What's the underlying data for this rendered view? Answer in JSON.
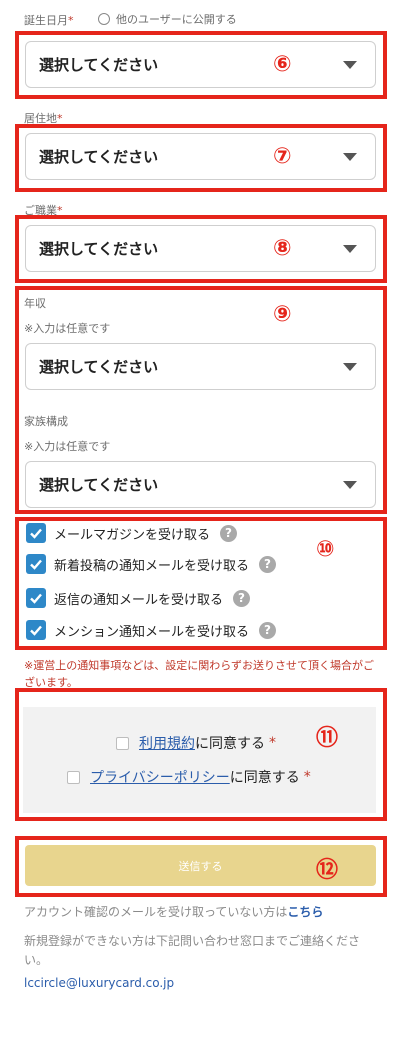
{
  "birthday": {
    "label": "誕生日月",
    "required_mark": "*",
    "public_checkbox_label": "他のユーザーに公開する",
    "select_value": "選択してください",
    "marker": "⑥"
  },
  "residence": {
    "label": "居住地",
    "required_mark": "*",
    "select_value": "選択してください",
    "marker": "⑦"
  },
  "occupation": {
    "label": "ご職業",
    "required_mark": "*",
    "select_value": "選択してください",
    "marker": "⑧"
  },
  "optional": {
    "marker": "⑨",
    "income_label": "年収",
    "income_note": "※入力は任意です",
    "income_value": "選択してください",
    "family_label": "家族構成",
    "family_note": "※入力は任意です",
    "family_value": "選択してください"
  },
  "notifications": {
    "marker": "⑩",
    "items": [
      {
        "label": "メールマガジンを受け取る",
        "checked": true
      },
      {
        "label": "新着投稿の通知メールを受け取る",
        "checked": true
      },
      {
        "label": "返信の通知メールを受け取る",
        "checked": true
      },
      {
        "label": "メンション通知メールを受け取る",
        "checked": true
      }
    ],
    "help_glyph": "?",
    "notice": "※運営上の通知事項などは、設定に関わらずお送りさせて頂く場合がございます。"
  },
  "agreements": {
    "marker": "⑪",
    "terms_link": "利用規約",
    "terms_suffix": "に同意する",
    "privacy_link": "プライバシーポリシー",
    "privacy_suffix": "に同意する",
    "required_mark": "*"
  },
  "submit": {
    "label": "送信する",
    "marker": "⑫"
  },
  "footer": {
    "resend_text": "アカウント確認のメールを受け取っていない方は",
    "resend_link": "こちら",
    "contact_text": "新規登録ができない方は下記問い合わせ窓口までご連絡ください。",
    "email": "lccircle@luxurycard.co.jp"
  },
  "colors": {
    "highlight_red": "#e5251b",
    "checkbox_blue": "#2e88c8",
    "submit_gold": "#e8d58e",
    "link_blue": "#2b5dab"
  }
}
